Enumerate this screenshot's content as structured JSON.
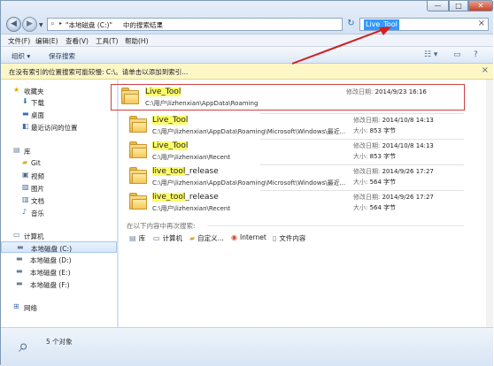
{
  "address": {
    "crumbs": [
      "\"本地磁盘 (C:)\"",
      "中的搜索结果"
    ],
    "search_value": "Live_Tool"
  },
  "window_controls": {
    "minimize": "—",
    "maximize": "□",
    "close": "✕"
  },
  "menu": [
    "文件(F)",
    "编辑(E)",
    "查看(V)",
    "工具(T)",
    "帮助(H)"
  ],
  "toolbar": {
    "organize": "组织 ▾",
    "save_search": "保存搜索"
  },
  "infobar": {
    "text": "在没有索引的位置搜索可能较慢: C:\\。请单击以添加到索引...",
    "close": "×"
  },
  "nav": {
    "favorites": "收藏夹",
    "favorites_items": [
      "下载",
      "桌面",
      "最近访问的位置"
    ],
    "libraries": "库",
    "library_items": [
      "Git",
      "视频",
      "图片",
      "文档",
      "音乐"
    ],
    "computer": "计算机",
    "drives": [
      "本地磁盘 (C:)",
      "本地磁盘 (D:)",
      "本地磁盘 (E:)",
      "本地磁盘 (F:)"
    ],
    "network": "网络"
  },
  "results": [
    {
      "name": "Live_Tool",
      "highlight": "Live_Tool",
      "rest": "",
      "path": "C:\\用户\\lizhenxian\\AppData\\Roaming",
      "label1": "修改日期:",
      "value1": "2014/9/23 16:16",
      "label2": "",
      "value2": ""
    },
    {
      "name": "Live_Tool",
      "highlight": "Live_Tool",
      "rest": "",
      "path": "C:\\用户\\lizhenxian\\AppData\\Roaming\\Microsoft\\Windows\\最近...",
      "label1": "修改日期:",
      "value1": "2014/10/8 14:13",
      "label2": "大小:",
      "value2": "853 字节"
    },
    {
      "name": "Live_Tool",
      "highlight": "Live_Tool",
      "rest": "",
      "path": "C:\\用户\\lizhenxian\\Recent",
      "label1": "修改日期:",
      "value1": "2014/10/8 14:13",
      "label2": "大小:",
      "value2": "853 字节"
    },
    {
      "name": "live_tool_release",
      "highlight": "live_tool",
      "rest": "_release",
      "path": "C:\\用户\\lizhenxian\\AppData\\Roaming\\Microsoft\\Windows\\最近...",
      "label1": "修改日期:",
      "value1": "2014/9/26 17:27",
      "label2": "大小:",
      "value2": "564 字节"
    },
    {
      "name": "live_tool_release",
      "highlight": "live_tool",
      "rest": "_release",
      "path": "C:\\用户\\lizhenxian\\Recent",
      "label1": "修改日期:",
      "value1": "2014/9/26 17:27",
      "label2": "大小:",
      "value2": "564 字节"
    }
  ],
  "search_again": {
    "label": "在以下内容中再次搜索:",
    "locations": [
      "库",
      "计算机",
      "自定义...",
      "Internet",
      "文件内容"
    ]
  },
  "status": {
    "count": "5 个对象"
  },
  "colors": {
    "highlight": "#fcfc6a",
    "selection": "#3399ff",
    "annotation": "#d02020"
  }
}
